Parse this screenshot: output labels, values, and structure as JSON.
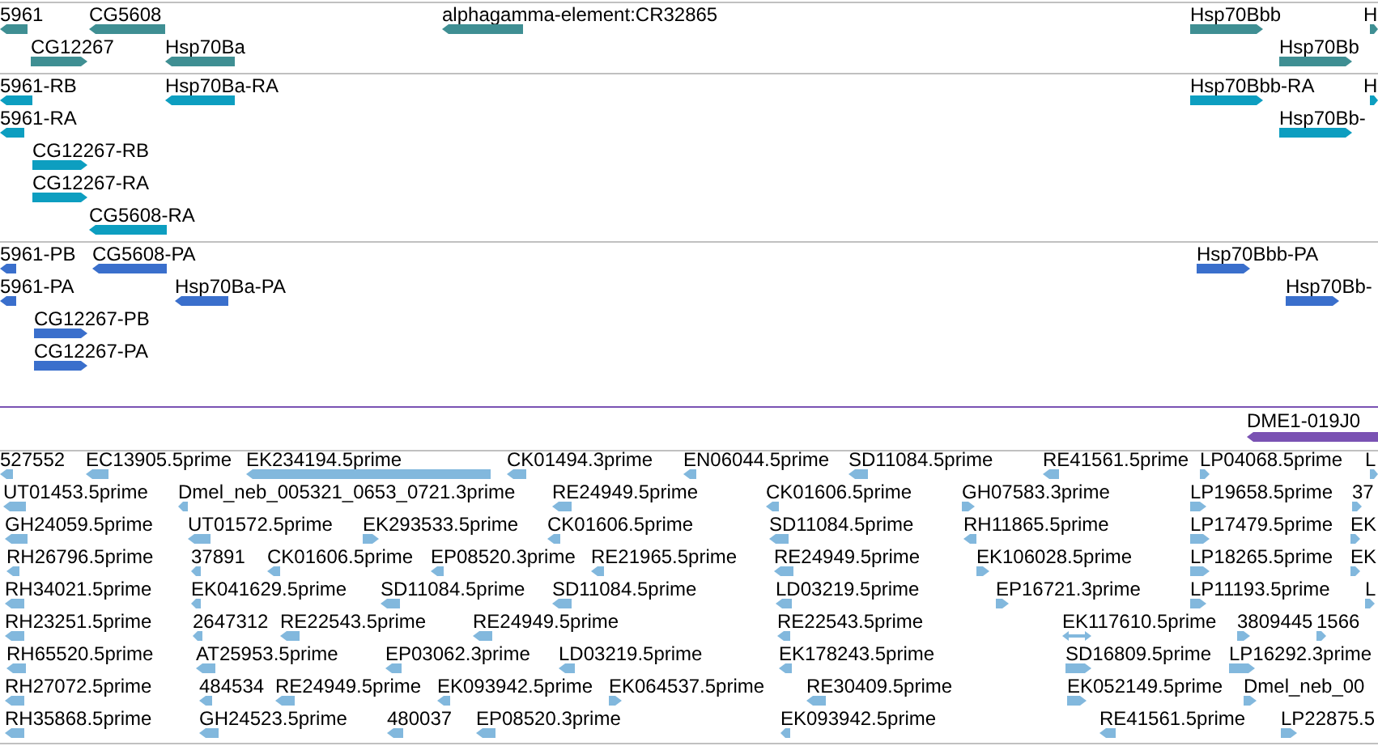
{
  "tracks": [
    {
      "kind": "gene",
      "lanes": [
        {
          "features": [
            {
              "label": "5961",
              "kind": "reverse"
            },
            {
              "label": "CG5608",
              "kind": "reverse"
            },
            {
              "label": "alphagamma-element:CR32865",
              "kind": "reverse"
            },
            {
              "label": "Hsp70Bbb",
              "kind": "forward"
            },
            {
              "label": "H",
              "kind": "forward"
            }
          ]
        },
        {
          "features": [
            {
              "label": "CG12267",
              "kind": "forward"
            },
            {
              "label": "Hsp70Ba",
              "kind": "reverse"
            },
            {
              "label": "Hsp70Bb",
              "kind": "forward"
            }
          ]
        }
      ]
    },
    {
      "kind": "transcript",
      "lanes": [
        {
          "features": [
            {
              "label": "5961-RB",
              "kind": "reverse"
            },
            {
              "label": "Hsp70Ba-RA",
              "kind": "reverse"
            },
            {
              "label": "Hsp70Bbb-RA",
              "kind": "forward"
            },
            {
              "label": "H",
              "kind": "forward"
            }
          ]
        },
        {
          "features": [
            {
              "label": "5961-RA",
              "kind": "reverse"
            },
            {
              "label": "Hsp70Bb-",
              "kind": "forward"
            }
          ]
        },
        {
          "features": [
            {
              "label": "CG12267-RB",
              "kind": "forward"
            }
          ]
        },
        {
          "features": [
            {
              "label": "CG12267-RA",
              "kind": "forward"
            }
          ]
        },
        {
          "features": [
            {
              "label": "CG5608-RA",
              "kind": "reverse"
            }
          ]
        }
      ]
    },
    {
      "kind": "protein",
      "lanes": [
        {
          "features": [
            {
              "label": "5961-PB",
              "kind": "reverse"
            },
            {
              "label": "CG5608-PA",
              "kind": "reverse"
            },
            {
              "label": "Hsp70Bbb-PA",
              "kind": "forward"
            }
          ]
        },
        {
          "features": [
            {
              "label": "5961-PA",
              "kind": "reverse"
            },
            {
              "label": "Hsp70Ba-PA",
              "kind": "reverse"
            },
            {
              "label": "Hsp70Bb-",
              "kind": "forward"
            }
          ]
        },
        {
          "features": [
            {
              "label": "CG12267-PB",
              "kind": "forward"
            }
          ]
        },
        {
          "features": [
            {
              "label": "CG12267-PA",
              "kind": "forward"
            }
          ]
        }
      ]
    },
    {
      "kind": "clone",
      "lanes": [
        {
          "features": [
            {
              "label": "DME1-019J0",
              "kind": "reverse"
            }
          ]
        }
      ]
    },
    {
      "kind": "est",
      "lanes": [
        {
          "features": [
            {
              "label": "527552",
              "kind": "reverse"
            },
            {
              "label": "EC13905.5prime",
              "kind": "reverse"
            },
            {
              "label": "EK234194.5prime",
              "kind": "reverse"
            },
            {
              "label": "CK01494.3prime",
              "kind": "reverse"
            },
            {
              "label": "EN06044.5prime",
              "kind": "reverse"
            },
            {
              "label": "SD11084.5prime",
              "kind": "reverse"
            },
            {
              "label": "RE41561.5prime",
              "kind": "reverse"
            },
            {
              "label": "LP04068.5prime",
              "kind": "forward"
            },
            {
              "label": "L",
              "kind": "forward"
            }
          ]
        },
        {
          "features": [
            {
              "label": "UT01453.5prime",
              "kind": "reverse"
            },
            {
              "label": "Dmel_neb_005321_0653_0721.3prime",
              "kind": "reverse"
            },
            {
              "label": "RE24949.5prime",
              "kind": "reverse"
            },
            {
              "label": "CK01606.5prime",
              "kind": "reverse"
            },
            {
              "label": "GH07583.3prime",
              "kind": "forward"
            },
            {
              "label": "LP19658.5prime",
              "kind": "forward"
            },
            {
              "label": "37",
              "kind": "forward"
            }
          ]
        },
        {
          "features": [
            {
              "label": "GH24059.5prime",
              "kind": "reverse"
            },
            {
              "label": "UT01572.5prime",
              "kind": "reverse"
            },
            {
              "label": "EK293533.5prime",
              "kind": "forward"
            },
            {
              "label": "CK01606.5prime",
              "kind": "reverse"
            },
            {
              "label": "SD11084.5prime",
              "kind": "reverse"
            },
            {
              "label": "RH11865.5prime",
              "kind": "reverse"
            },
            {
              "label": "LP17479.5prime",
              "kind": "forward"
            },
            {
              "label": "EK",
              "kind": "forward"
            }
          ]
        },
        {
          "features": [
            {
              "label": "RH26796.5prime",
              "kind": "reverse"
            },
            {
              "label": "37891",
              "kind": "reverse"
            },
            {
              "label": "CK01606.5prime",
              "kind": "reverse"
            },
            {
              "label": "EP08520.3prime",
              "kind": "reverse"
            },
            {
              "label": "RE21965.5prime",
              "kind": "reverse"
            },
            {
              "label": "RE24949.5prime",
              "kind": "reverse"
            },
            {
              "label": "EK106028.5prime",
              "kind": "forward"
            },
            {
              "label": "LP18265.5prime",
              "kind": "forward"
            },
            {
              "label": "EK",
              "kind": "forward"
            }
          ]
        },
        {
          "features": [
            {
              "label": "RH34021.5prime",
              "kind": "reverse"
            },
            {
              "label": "EK041629.5prime",
              "kind": "reverse"
            },
            {
              "label": "SD11084.5prime",
              "kind": "reverse"
            },
            {
              "label": "SD11084.5prime",
              "kind": "reverse"
            },
            {
              "label": "LD03219.5prime",
              "kind": "reverse"
            },
            {
              "label": "EP16721.3prime",
              "kind": "forward"
            },
            {
              "label": "LP11193.5prime",
              "kind": "forward"
            },
            {
              "label": "L",
              "kind": "forward"
            }
          ]
        },
        {
          "features": [
            {
              "label": "RH23251.5prime",
              "kind": "reverse"
            },
            {
              "label": "2647312",
              "kind": "reverse"
            },
            {
              "label": "RE22543.5prime",
              "kind": "reverse"
            },
            {
              "label": "RE24949.5prime",
              "kind": "reverse"
            },
            {
              "label": "RE22543.5prime",
              "kind": "reverse"
            },
            {
              "label": "EK117610.5prime",
              "kind": "both"
            },
            {
              "label": "3809445",
              "kind": "forward"
            },
            {
              "label": "1566",
              "kind": "forward"
            }
          ]
        },
        {
          "features": [
            {
              "label": "RH65520.5prime",
              "kind": "reverse"
            },
            {
              "label": "AT25953.5prime",
              "kind": "reverse"
            },
            {
              "label": "EP03062.3prime",
              "kind": "reverse"
            },
            {
              "label": "LD03219.5prime",
              "kind": "reverse"
            },
            {
              "label": "EK178243.5prime",
              "kind": "reverse"
            },
            {
              "label": "SD16809.5prime",
              "kind": "forward"
            },
            {
              "label": "LP16292.3prime",
              "kind": "forward"
            }
          ]
        },
        {
          "features": [
            {
              "label": "RH27072.5prime",
              "kind": "reverse"
            },
            {
              "label": "484534",
              "kind": "reverse"
            },
            {
              "label": "RE24949.5prime",
              "kind": "reverse"
            },
            {
              "label": "EK093942.5prime",
              "kind": "reverse"
            },
            {
              "label": "EK064537.5prime",
              "kind": "forward"
            },
            {
              "label": "RE30409.5prime",
              "kind": "reverse"
            },
            {
              "label": "EK052149.5prime",
              "kind": "forward"
            },
            {
              "label": "Dmel_neb_00",
              "kind": "forward"
            }
          ]
        },
        {
          "features": [
            {
              "label": "RH35868.5prime",
              "kind": "reverse"
            },
            {
              "label": "GH24523.5prime",
              "kind": "reverse"
            },
            {
              "label": "480037",
              "kind": "reverse"
            },
            {
              "label": "EP08520.3prime",
              "kind": "reverse"
            },
            {
              "label": "EK093942.5prime",
              "kind": "reverse"
            },
            {
              "label": "RE41561.5prime",
              "kind": "reverse"
            },
            {
              "label": "LP22875.5",
              "kind": "forward"
            }
          ]
        }
      ]
    }
  ]
}
